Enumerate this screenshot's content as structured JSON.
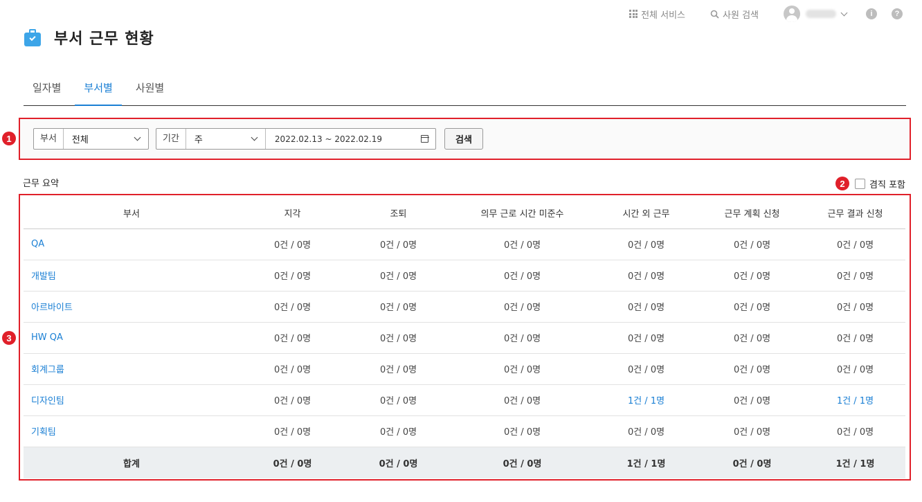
{
  "topbar": {
    "services_label": "전체 서비스",
    "search_label": "사원 검색"
  },
  "page": {
    "title": "부서 근무 현황"
  },
  "tabs": [
    {
      "label": "일자별",
      "active": false
    },
    {
      "label": "부서별",
      "active": true
    },
    {
      "label": "사원별",
      "active": false
    }
  ],
  "markers": [
    "1",
    "2",
    "3"
  ],
  "filters": {
    "dept_label": "부서",
    "dept_value": "전체",
    "period_label": "기간",
    "period_value": "주",
    "date_range": "2022.02.13 ~ 2022.02.19",
    "search_button": "검색"
  },
  "summary": {
    "title": "근무 요약",
    "concurrent_label": "겸직 포함",
    "concurrent_checked": false
  },
  "table": {
    "headers": [
      "부서",
      "지각",
      "조퇴",
      "의무 근로 시간 미준수",
      "시간 외 근무",
      "근무 계획 신청",
      "근무 결과 신청"
    ],
    "rows": [
      {
        "dept": "QA",
        "late": "0건 / 0명",
        "early": "0건 / 0명",
        "mandatory": "0건 / 0명",
        "overtime": "0건 / 0명",
        "plan": "0건 / 0명",
        "result": "0건 / 0명"
      },
      {
        "dept": "개발팀",
        "late": "0건 / 0명",
        "early": "0건 / 0명",
        "mandatory": "0건 / 0명",
        "overtime": "0건 / 0명",
        "plan": "0건 / 0명",
        "result": "0건 / 0명"
      },
      {
        "dept": "아르바이트",
        "late": "0건 / 0명",
        "early": "0건 / 0명",
        "mandatory": "0건 / 0명",
        "overtime": "0건 / 0명",
        "plan": "0건 / 0명",
        "result": "0건 / 0명"
      },
      {
        "dept": "HW QA",
        "late": "0건 / 0명",
        "early": "0건 / 0명",
        "mandatory": "0건 / 0명",
        "overtime": "0건 / 0명",
        "plan": "0건 / 0명",
        "result": "0건 / 0명"
      },
      {
        "dept": "회계그룹",
        "late": "0건 / 0명",
        "early": "0건 / 0명",
        "mandatory": "0건 / 0명",
        "overtime": "0건 / 0명",
        "plan": "0건 / 0명",
        "result": "0건 / 0명"
      },
      {
        "dept": "디자인팀",
        "late": "0건 / 0명",
        "early": "0건 / 0명",
        "mandatory": "0건 / 0명",
        "overtime": "1건 / 1명",
        "plan": "0건 / 0명",
        "result": "1건 / 1명"
      },
      {
        "dept": "기획팀",
        "late": "0건 / 0명",
        "early": "0건 / 0명",
        "mandatory": "0건 / 0명",
        "overtime": "0건 / 0명",
        "plan": "0건 / 0명",
        "result": "0건 / 0명"
      }
    ],
    "total": {
      "label": "합계",
      "late": "0건 / 0명",
      "early": "0건 / 0명",
      "mandatory": "0건 / 0명",
      "overtime": "1건 / 1명",
      "plan": "0건 / 0명",
      "result": "1건 / 1명"
    }
  },
  "colors": {
    "accent": "#1a7fd4",
    "marker": "#e0202a",
    "icon_blue": "#3da5e8"
  }
}
